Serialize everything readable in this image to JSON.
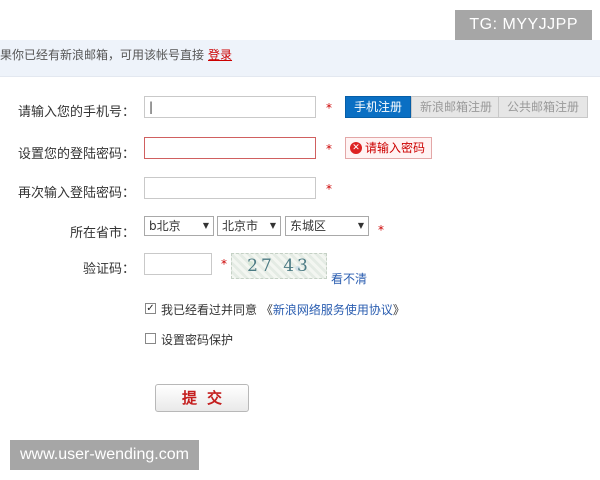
{
  "watermark": {
    "tag": "TG: MYYJJPP",
    "url": "www.user-wending.com"
  },
  "notice": {
    "text": "果你已经有新浪邮箱，可用该帐号直接",
    "login_link": "登录"
  },
  "phone": {
    "label": "请输入您的手机号：",
    "value": "|",
    "required": "*",
    "tabs": [
      "手机注册",
      "新浪邮箱注册",
      "公共邮箱注册"
    ]
  },
  "password": {
    "label": "设置您的登陆密码：",
    "value": "",
    "required": "*",
    "error": "请输入密码"
  },
  "confirm": {
    "label": "再次输入登陆密码：",
    "value": "",
    "required": "*"
  },
  "region": {
    "label": "所在省市：",
    "province": "b北京",
    "city": "北京市",
    "district": "东城区",
    "required": "*"
  },
  "captcha": {
    "label": "验证码：",
    "value": "",
    "required": "*",
    "image_text": "27 43",
    "refresh": "看不清"
  },
  "agree": {
    "checked": true,
    "text": "我已经看过并同意",
    "open_quote": "《",
    "agreement": "新浪网络服务使用协议",
    "close_quote": "》"
  },
  "protect": {
    "checked": false,
    "text": "设置密码保护"
  },
  "submit": {
    "label": "提交"
  }
}
